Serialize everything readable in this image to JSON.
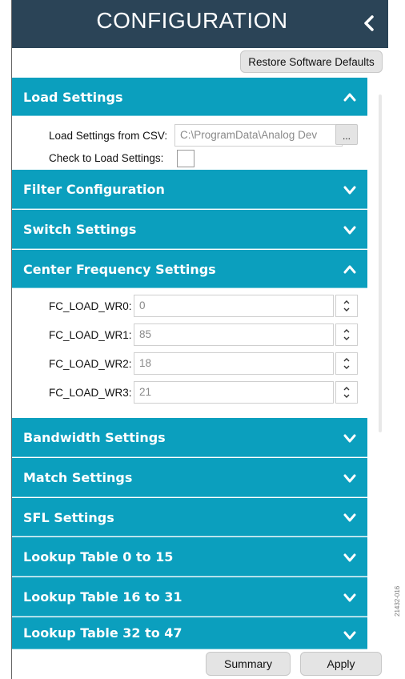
{
  "header": {
    "title": "CONFIGURATION",
    "close_icon": "chevron-left-icon"
  },
  "toolbar": {
    "restore_label": "Restore Software Defaults"
  },
  "load_settings": {
    "title": "Load Settings",
    "csv_label": "Load Settings from CSV:",
    "csv_value": "C:\\ProgramData\\Analog Dev",
    "browse_label": "...",
    "check_label": "Check to Load Settings:",
    "check_value": false
  },
  "sections": {
    "filter_configuration": "Filter Configuration",
    "switch_settings": "Switch Settings",
    "center_frequency_settings": "Center Frequency Settings",
    "bandwidth_settings": "Bandwidth Settings",
    "match_settings": "Match Settings",
    "sfl_settings": "SFL Settings",
    "lookup_0_15": "Lookup Table 0 to 15",
    "lookup_16_31": "Lookup Table 16 to 31",
    "lookup_32_47": "Lookup Table 32 to 47"
  },
  "center_frequency": {
    "fields": [
      {
        "label": "FC_LOAD_WR0:",
        "value": "0"
      },
      {
        "label": "FC_LOAD_WR1:",
        "value": "85"
      },
      {
        "label": "FC_LOAD_WR2:",
        "value": "18"
      },
      {
        "label": "FC_LOAD_WR3:",
        "value": "21"
      }
    ]
  },
  "footer": {
    "summary_label": "Summary",
    "apply_label": "Apply"
  },
  "colors": {
    "header_bg": "#2b4457",
    "section_bg": "#0b9fbe"
  },
  "side_number": "21432-016"
}
